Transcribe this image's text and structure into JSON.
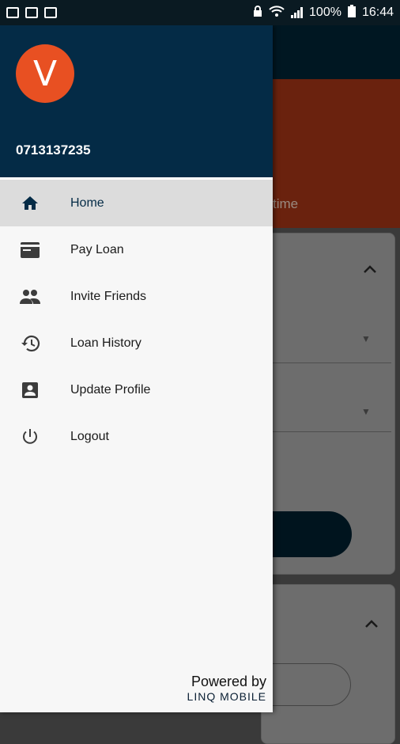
{
  "status_bar": {
    "battery": "100%",
    "time": "16:44",
    "left_icons": [
      "image-icon",
      "laptop-icon",
      "activity-icon"
    ],
    "right_icons": [
      "lock-icon",
      "wifi-icon",
      "signal-icon",
      "battery-icon"
    ]
  },
  "background": {
    "banner_text": "time"
  },
  "drawer": {
    "avatar_letter": "V",
    "phone": "0713137235",
    "items": [
      {
        "label": "Home",
        "icon": "home-icon",
        "active": true
      },
      {
        "label": "Pay Loan",
        "icon": "card-icon",
        "active": false
      },
      {
        "label": "Invite Friends",
        "icon": "people-icon",
        "active": false
      },
      {
        "label": "Loan History",
        "icon": "history-icon",
        "active": false
      },
      {
        "label": "Update Profile",
        "icon": "profile-icon",
        "active": false
      },
      {
        "label": "Logout",
        "icon": "power-icon",
        "active": false
      }
    ],
    "footer": {
      "powered_by": "Powered by",
      "brand": "LINQ MOBILE"
    }
  },
  "colors": {
    "header": "#042b46",
    "avatar": "#e85022",
    "active_item_bg": "#dcdcdc",
    "icon": "#3c3c3c"
  }
}
